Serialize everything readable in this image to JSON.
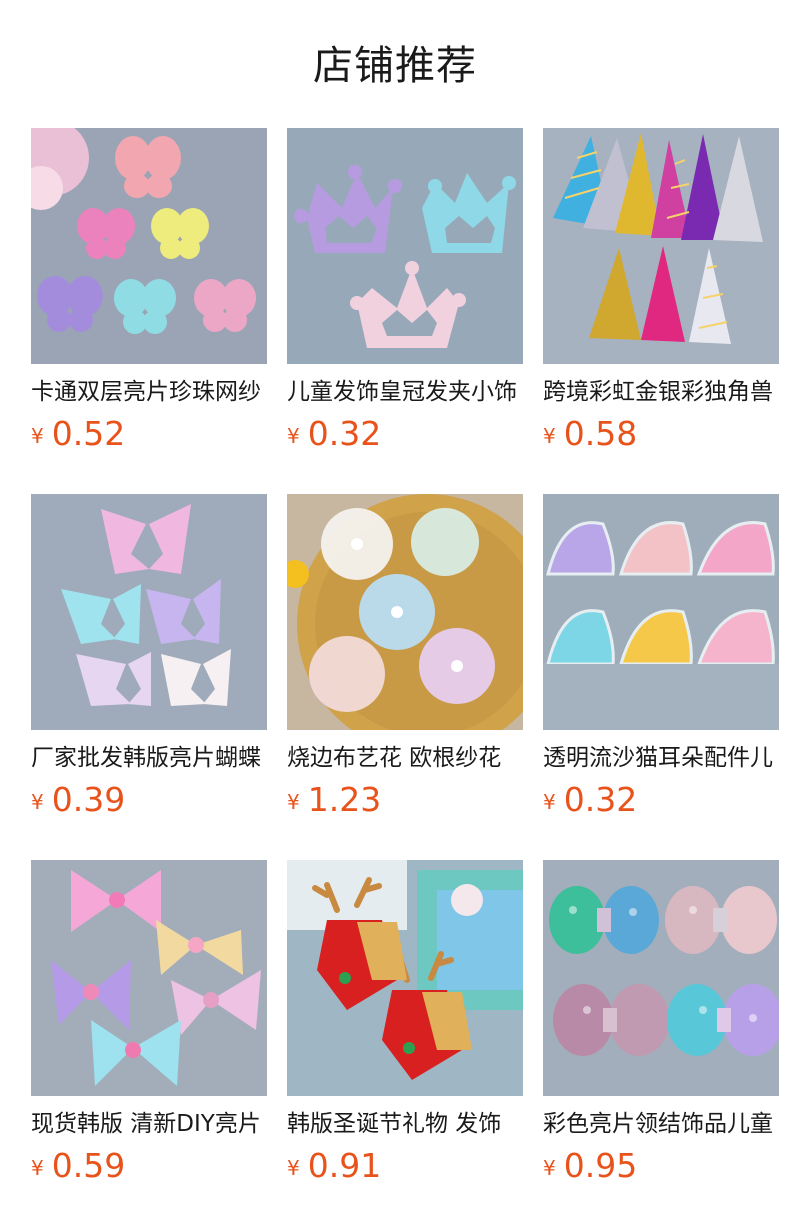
{
  "header": {
    "title": "店铺推荐"
  },
  "currency": "¥",
  "colors": {
    "price": "#e8531c"
  },
  "products": [
    {
      "name": "卡通双层亮片珍珠网纱",
      "price": "0.52",
      "image": "butterfly-patches-image"
    },
    {
      "name": "儿童发饰皇冠发夹小饰",
      "price": "0.32",
      "image": "glitter-crown-image"
    },
    {
      "name": "跨境彩虹金银彩独角兽",
      "price": "0.58",
      "image": "unicorn-horn-image"
    },
    {
      "name": "厂家批发韩版亮片蝴蝶",
      "price": "0.39",
      "image": "glitter-butterfly-image"
    },
    {
      "name": "烧边布艺花 欧根纱花",
      "price": "1.23",
      "image": "organza-flower-image"
    },
    {
      "name": "透明流沙猫耳朵配件儿",
      "price": "0.32",
      "image": "cat-ear-shaker-image"
    },
    {
      "name": "现货韩版 清新DIY亮片",
      "price": "0.59",
      "image": "glitter-bow-image"
    },
    {
      "name": "韩版圣诞节礼物 发饰",
      "price": "0.91",
      "image": "christmas-antler-bow-image"
    },
    {
      "name": "彩色亮片领结饰品儿童",
      "price": "0.95",
      "image": "sequin-bow-image"
    }
  ]
}
